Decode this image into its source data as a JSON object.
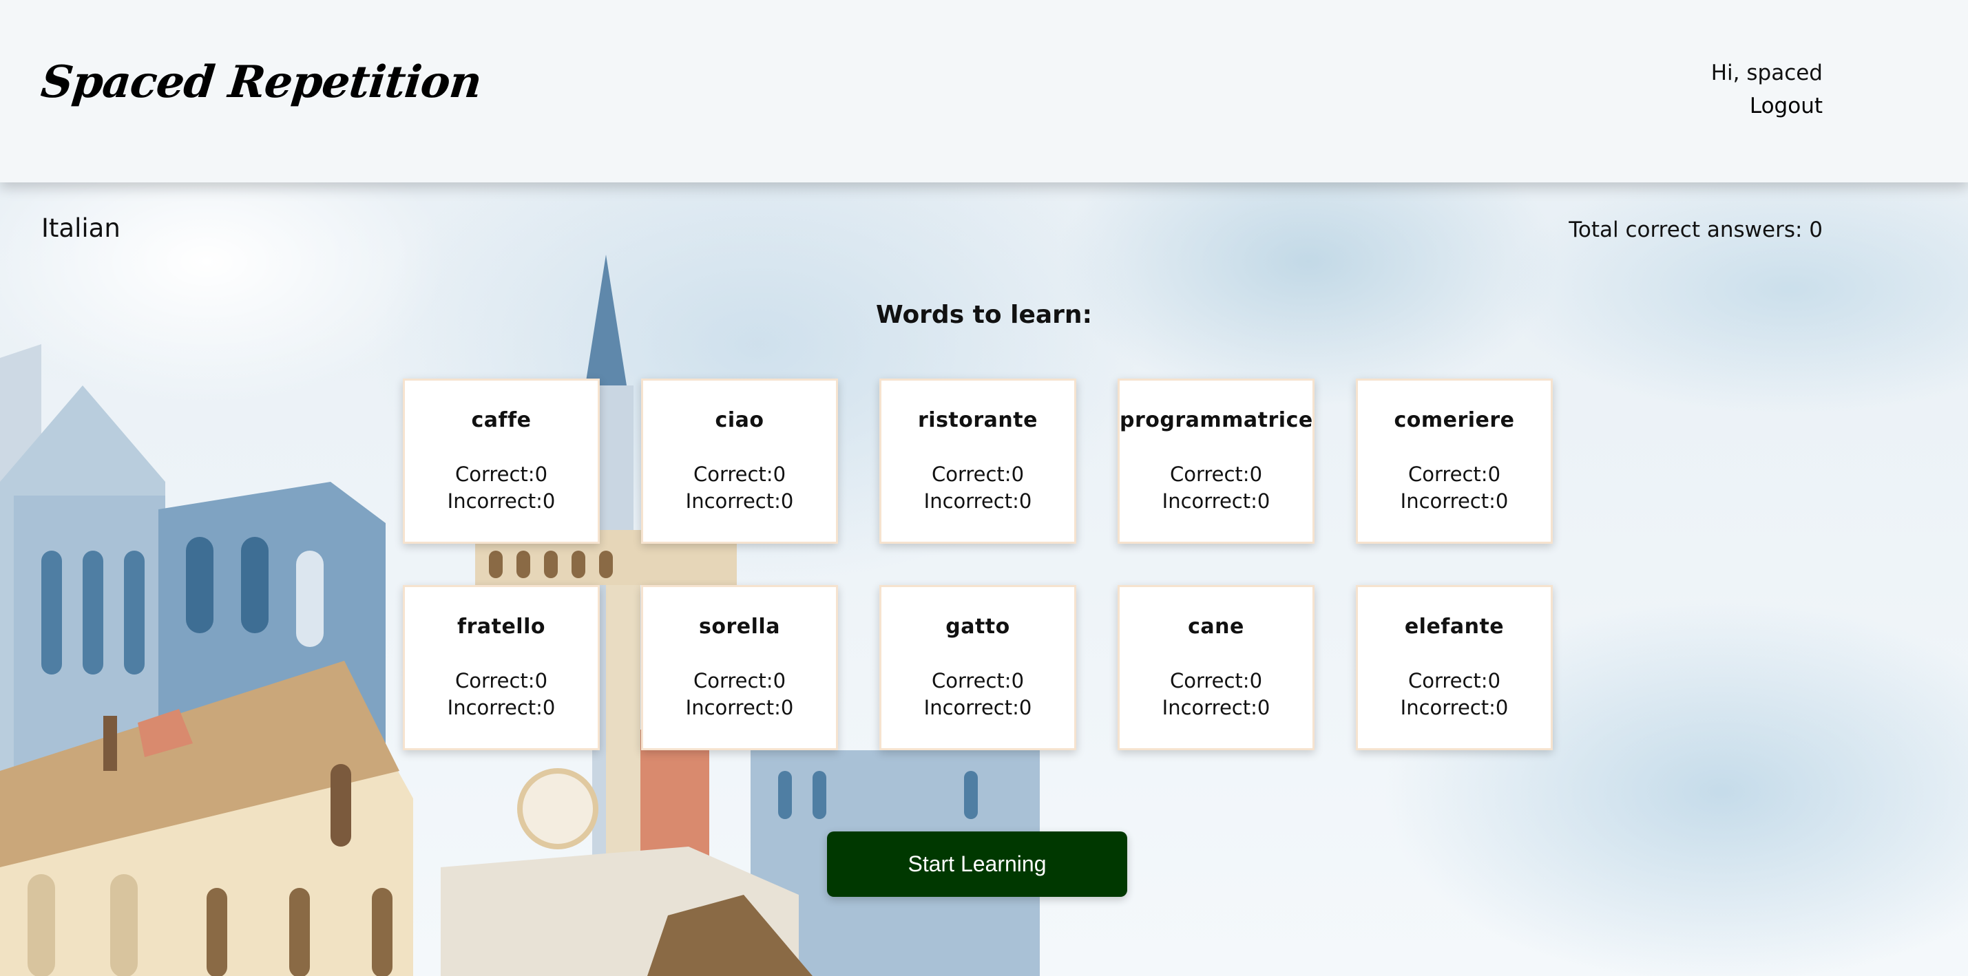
{
  "header": {
    "brand": "Spaced Repetition",
    "greeting": "Hi, spaced",
    "logout_label": "Logout"
  },
  "dashboard": {
    "language": "Italian",
    "total_correct_label": "Total correct answers: 0",
    "words_heading": "Words to learn:",
    "start_button_label": "Start Learning",
    "button_color": "#003800",
    "words": [
      {
        "word": "caffe",
        "correct": "Correct:0",
        "incorrect": "Incorrect:0"
      },
      {
        "word": "ciao",
        "correct": "Correct:0",
        "incorrect": "Incorrect:0"
      },
      {
        "word": "ristorante",
        "correct": "Correct:0",
        "incorrect": "Incorrect:0"
      },
      {
        "word": "programmatrice",
        "correct": "Correct:0",
        "incorrect": "Incorrect:0"
      },
      {
        "word": "comeriere",
        "correct": "Correct:0",
        "incorrect": "Incorrect:0"
      },
      {
        "word": "fratello",
        "correct": "Correct:0",
        "incorrect": "Incorrect:0"
      },
      {
        "word": "sorella",
        "correct": "Correct:0",
        "incorrect": "Incorrect:0"
      },
      {
        "word": "gatto",
        "correct": "Correct:0",
        "incorrect": "Incorrect:0"
      },
      {
        "word": "cane",
        "correct": "Correct:0",
        "incorrect": "Incorrect:0"
      },
      {
        "word": "elefante",
        "correct": "Correct:0",
        "incorrect": "Incorrect:0"
      }
    ]
  }
}
